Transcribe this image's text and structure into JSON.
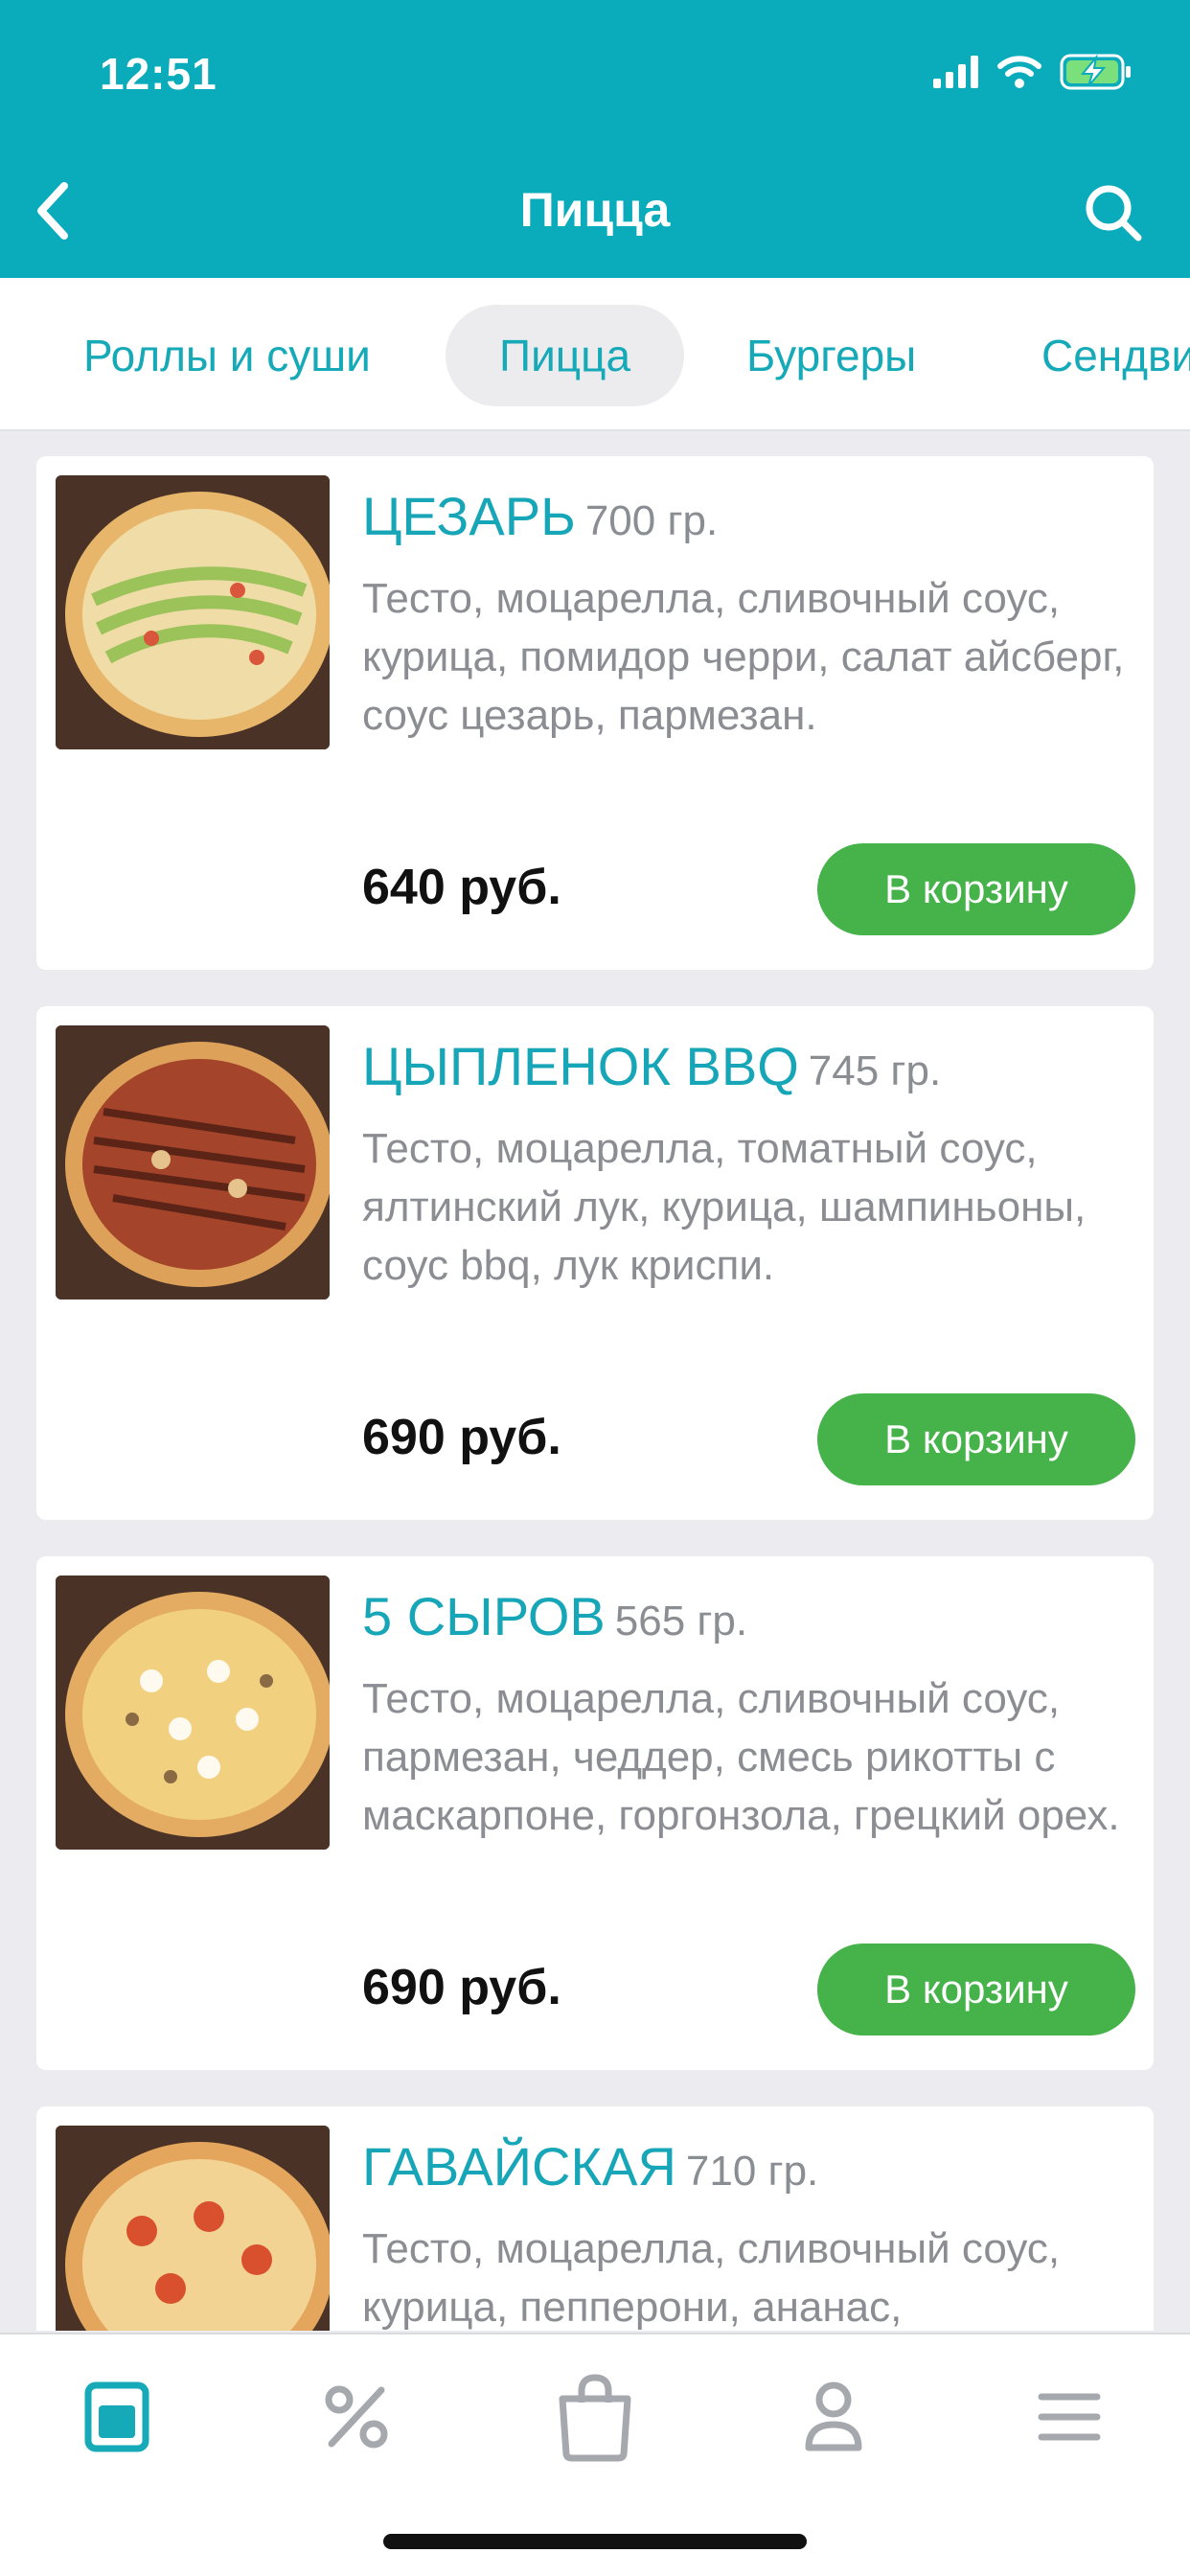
{
  "status_bar": {
    "time": "12:51"
  },
  "header": {
    "title": "Пицца"
  },
  "tabs": [
    {
      "label": "Роллы и суши",
      "active": false
    },
    {
      "label": "Пицца",
      "active": true
    },
    {
      "label": "Бургеры",
      "active": false
    },
    {
      "label": "Сендвичи",
      "active": false
    }
  ],
  "products": [
    {
      "name": "ЦЕЗАРЬ",
      "weight": "700 гр.",
      "description": "Тесто, моцарелла, сливочный соус, курица, помидор черри, салат айсберг, соус цезарь, пармезан.",
      "price": "640 руб.",
      "button": "В корзину"
    },
    {
      "name": "ЦЫПЛЕНОК BBQ",
      "weight": "745 гр.",
      "description": "Тесто, моцарелла, томатный соус, ялтинский лук, курица, шампиньоны, соус bbq, лук криспи.",
      "price": "690 руб.",
      "button": "В корзину"
    },
    {
      "name": "5 СЫРОВ",
      "weight": "565 гр.",
      "description": "Тесто, моцарелла, сливочный соус, пармезан, чеддер, смесь рикотты с маскарпоне, горгонзола, грецкий орех.",
      "price": "690 руб.",
      "button": "В корзину"
    },
    {
      "name": "ГАВАЙСКАЯ",
      "weight": "710 гр.",
      "description": "Тесто, моцарелла, сливочный соус, курица, пепперони, ананас,",
      "price": "",
      "button": ""
    }
  ],
  "bottom_nav": [
    {
      "icon": "menu-book-icon",
      "active": true
    },
    {
      "icon": "percent-icon",
      "active": false
    },
    {
      "icon": "shopping-bag-icon",
      "active": false
    },
    {
      "icon": "profile-icon",
      "active": false
    },
    {
      "icon": "hamburger-menu-icon",
      "active": false
    }
  ],
  "colors": {
    "header": "#0aabbb",
    "accent": "#17a6b7",
    "button": "#45b24a"
  }
}
